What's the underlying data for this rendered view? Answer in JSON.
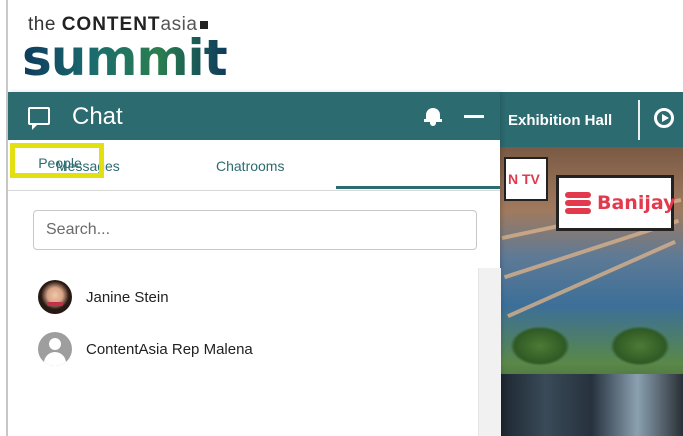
{
  "logo": {
    "the": "the",
    "content": "CONTENT",
    "asia": "asia",
    "summit": "summit"
  },
  "exhibition": {
    "nav_label": "Exhibition Hall",
    "booth_left_text": "N TV",
    "booth_banijay_text": "Banijay"
  },
  "chat": {
    "title": "Chat",
    "tabs": [
      {
        "label": "Messages"
      },
      {
        "label": "Chatrooms"
      },
      {
        "label": "People",
        "active": true
      }
    ],
    "search_placeholder": "Search...",
    "people": [
      {
        "name": "Janine Stein",
        "avatar": "photo"
      },
      {
        "name": "ContentAsia Rep Malena",
        "avatar": "default-user-icon"
      }
    ]
  },
  "colors": {
    "header": "#2c6b70",
    "highlight": "#e3e012",
    "banijay": "#e23a4c"
  },
  "icons": [
    "chat-bubble-icon",
    "bell-icon",
    "minimize-icon",
    "play-icon",
    "default-avatar-icon"
  ]
}
